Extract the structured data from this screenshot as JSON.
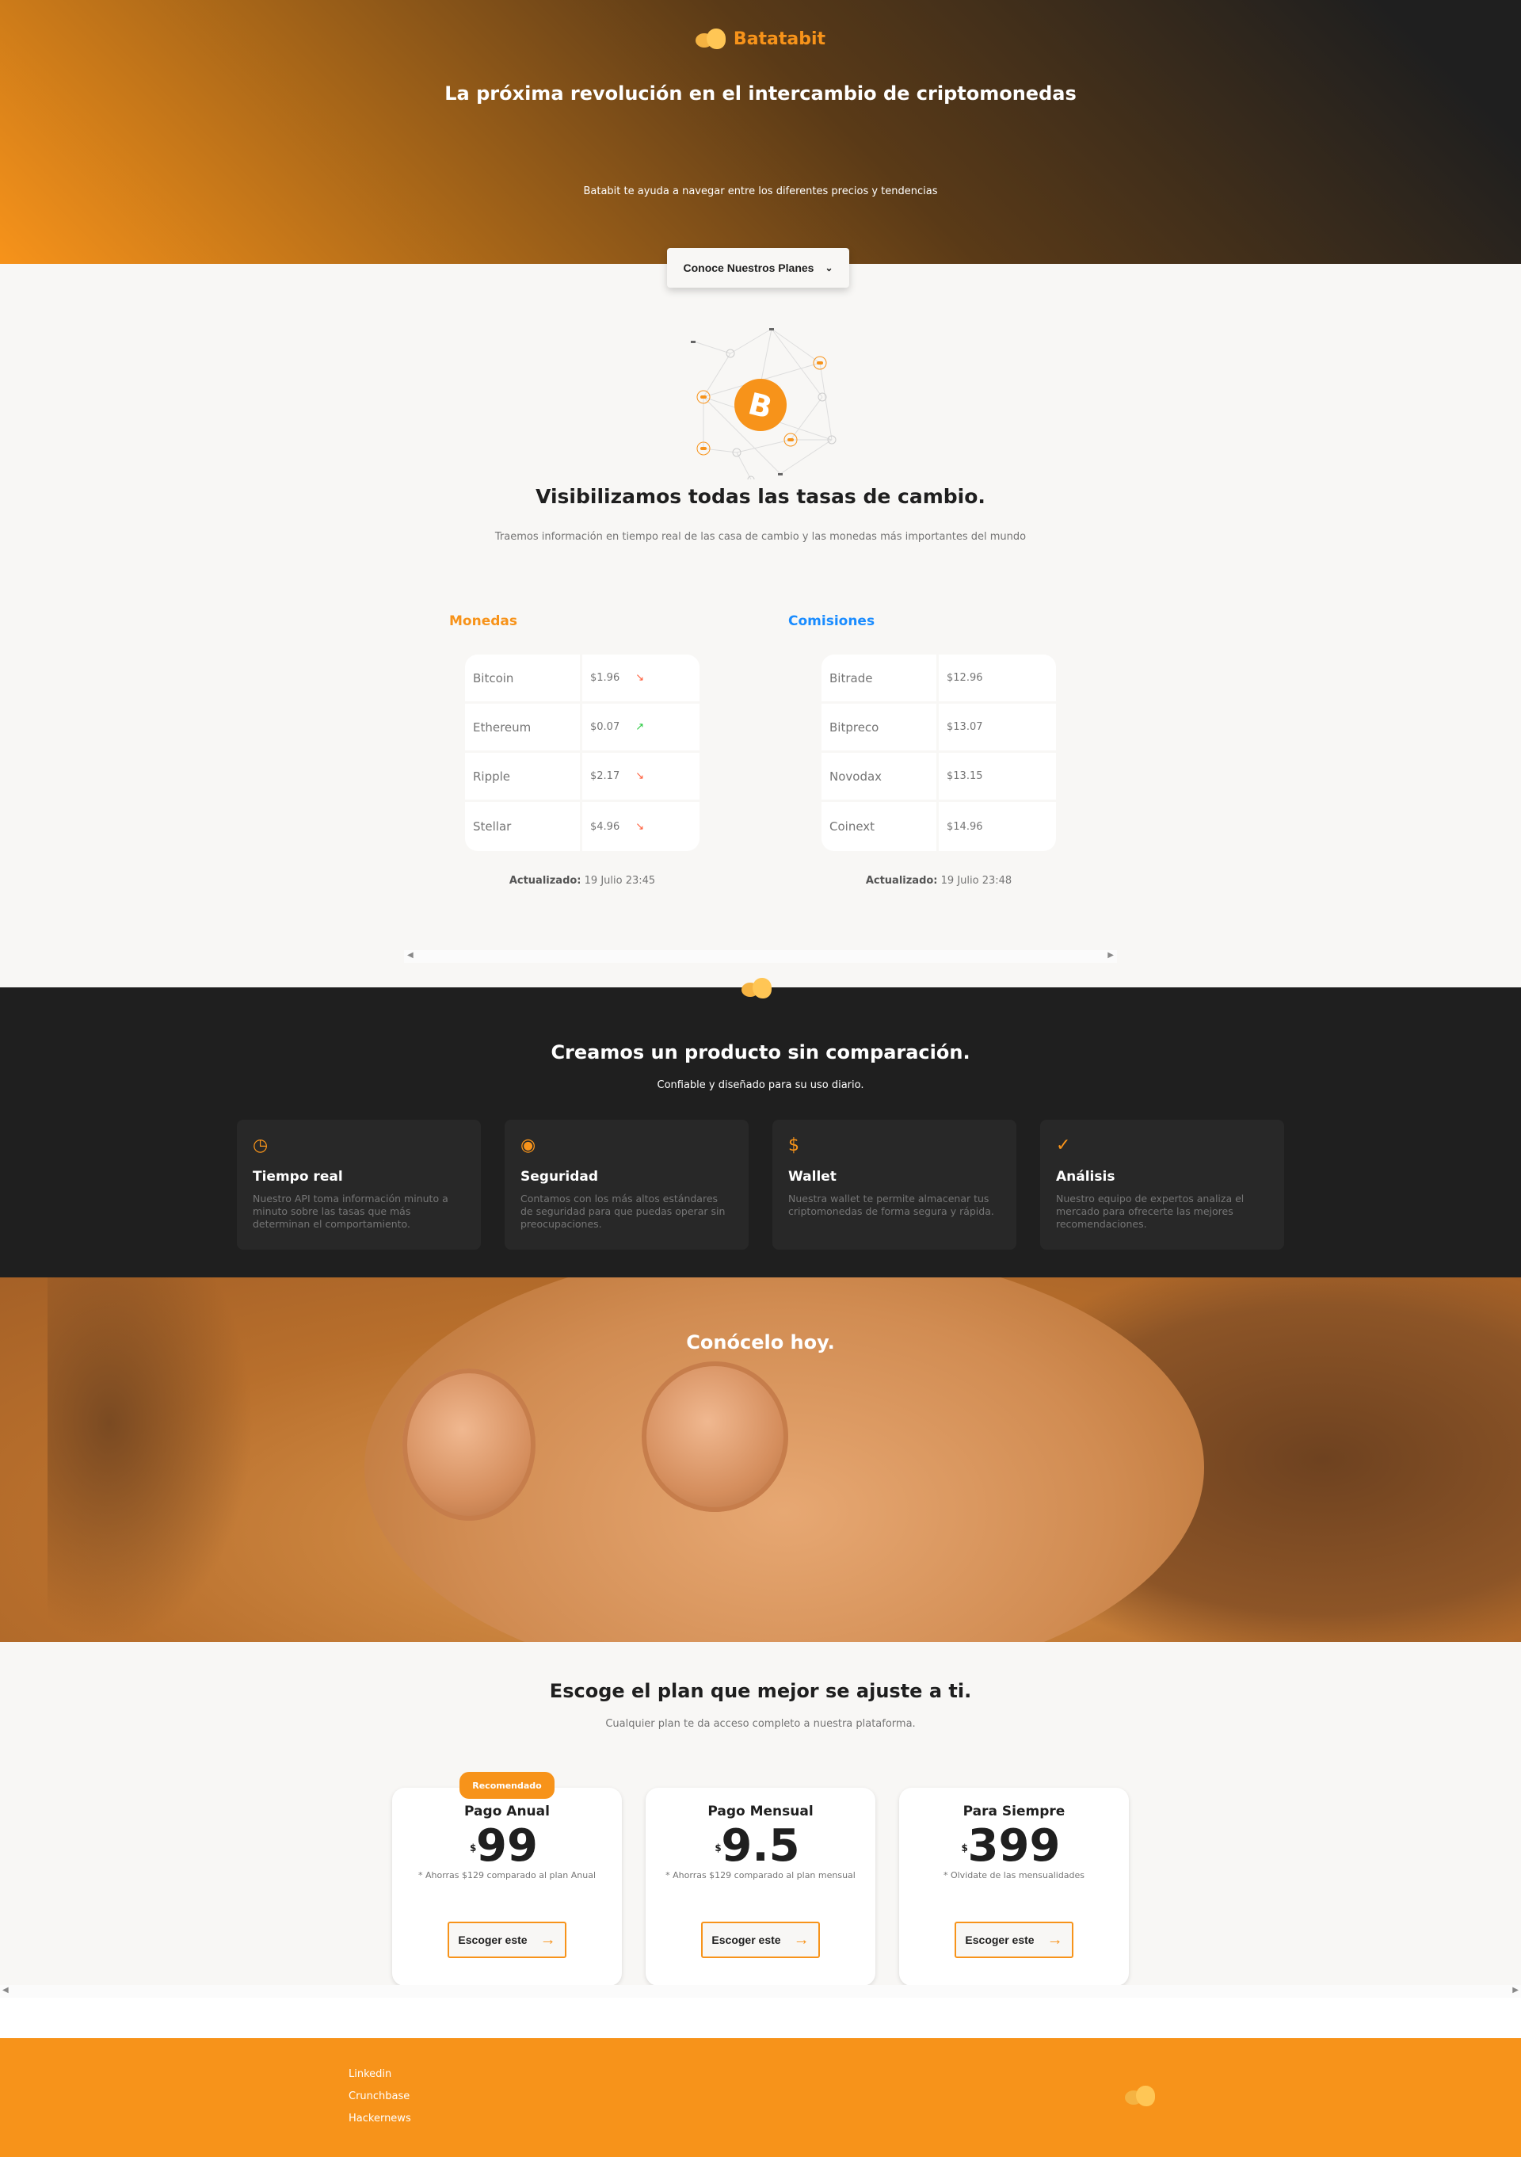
{
  "colors": {
    "accent": "#f7931a",
    "blue": "#1a8cff",
    "dark": "#1f1f1f",
    "up": "#27c93f",
    "down": "#ff5a36"
  },
  "header": {
    "brand": "Batatabit",
    "title": "La próxima revolución en el intercambio de criptomonedas",
    "subtitle": "Batabit te ayuda a navegar entre los diferentes precios y tendencias",
    "plans_button": "Conoce Nuestros Planes"
  },
  "rates": {
    "title": "Visibilizamos todas las tasas de cambio.",
    "subtitle": "Traemos información en tiempo real de las casa de cambio y las monedas más importantes del mundo",
    "coins": {
      "label": "Monedas",
      "rows": [
        {
          "name": "Bitcoin",
          "price": "$1.96",
          "trend": "down"
        },
        {
          "name": "Ethereum",
          "price": "$0.07",
          "trend": "up"
        },
        {
          "name": "Ripple",
          "price": "$2.17",
          "trend": "down"
        },
        {
          "name": "Stellar",
          "price": "$4.96",
          "trend": "down"
        }
      ],
      "updated_label": "Actualizado:",
      "updated_value": "19 Julio 23:45"
    },
    "fees": {
      "label": "Comisiones",
      "rows": [
        {
          "name": "Bitrade",
          "price": "$12.96"
        },
        {
          "name": "Bitpreco",
          "price": "$13.07"
        },
        {
          "name": "Novodax",
          "price": "$13.15"
        },
        {
          "name": "Coinext",
          "price": "$14.96"
        }
      ],
      "updated_label": "Actualizado:",
      "updated_value": "19 Julio 23:48"
    }
  },
  "product": {
    "title": "Creamos un producto sin comparación.",
    "subtitle": "Confiable y diseñado para su uso diario.",
    "features": [
      {
        "icon": "clock-icon",
        "title": "Tiempo real",
        "text": "Nuestro API toma información minuto a minuto sobre las tasas que más determinan el comportamiento."
      },
      {
        "icon": "eye-icon",
        "title": "Seguridad",
        "text": "Contamos con los más altos estándares de seguridad para que puedas operar sin preocupaciones."
      },
      {
        "icon": "dollar-icon",
        "title": "Wallet",
        "text": "Nuestra wallet te permite almacenar tus criptomonedas de forma segura y rápida."
      },
      {
        "icon": "check-circle-icon",
        "title": "Análisis",
        "text": "Nuestro equipo de expertos analiza el mercado para ofrecerte las mejores recomendaciones."
      }
    ]
  },
  "banner": {
    "title": "Conócelo hoy."
  },
  "plans": {
    "title": "Escoge el plan que mejor se ajuste a ti.",
    "subtitle": "Cualquier plan te da acceso completo a nuestra plataforma.",
    "badge": "Recomendado",
    "currency": "$",
    "items": [
      {
        "name": "Pago Anual",
        "price": "99",
        "note": "* Ahorras $129 comparado al plan Anual",
        "cta": "Escoger este"
      },
      {
        "name": "Pago Mensual",
        "price": "9.5",
        "note": "* Ahorras $129 comparado al plan mensual",
        "cta": "Escoger este"
      },
      {
        "name": "Para Siempre",
        "price": "399",
        "note": "* Olvidate de las mensualidades",
        "cta": "Escoger este"
      }
    ]
  },
  "footer": {
    "links": [
      "Linkedin",
      "Crunchbase",
      "Hackernews"
    ]
  }
}
